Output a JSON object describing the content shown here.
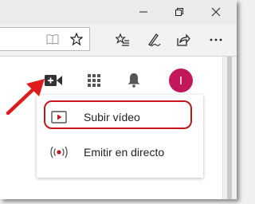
{
  "menu": {
    "items": [
      {
        "label": "Subir vídeo",
        "icon": "upload-video-icon"
      },
      {
        "label": "Emitir en directo",
        "icon": "live-broadcast-icon"
      }
    ]
  },
  "header": {
    "avatar_initial": "I"
  },
  "colors": {
    "highlight": "#c4161c",
    "avatar": "#c2185b",
    "arrow": "#e01b1b"
  }
}
